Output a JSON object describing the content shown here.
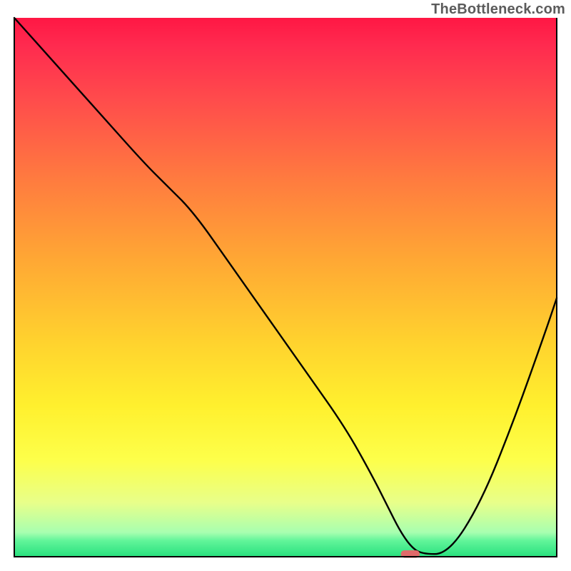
{
  "watermark": "TheBottleneck.com",
  "chart_data": {
    "type": "line",
    "title": "",
    "xlabel": "",
    "ylabel": "",
    "xlim": [
      0,
      100
    ],
    "ylim": [
      0,
      100
    ],
    "axes_visible": false,
    "grid": false,
    "legend": false,
    "background": {
      "type": "vertical-gradient",
      "description": "Vertical color gradient from red at top through orange, yellow, to green at bottom, indicating bottleneck severity by vertical position.",
      "stops": [
        {
          "pos": 0.0,
          "color": "#ff1744"
        },
        {
          "pos": 0.05,
          "color": "#ff2a4f"
        },
        {
          "pos": 0.15,
          "color": "#ff4b4c"
        },
        {
          "pos": 0.3,
          "color": "#ff7b3f"
        },
        {
          "pos": 0.45,
          "color": "#ffa834"
        },
        {
          "pos": 0.6,
          "color": "#ffd22e"
        },
        {
          "pos": 0.72,
          "color": "#fff02e"
        },
        {
          "pos": 0.82,
          "color": "#fdff4a"
        },
        {
          "pos": 0.9,
          "color": "#e8ff8a"
        },
        {
          "pos": 0.955,
          "color": "#a8ffb0"
        },
        {
          "pos": 0.97,
          "color": "#62f59a"
        },
        {
          "pos": 1.0,
          "color": "#28e07e"
        }
      ]
    },
    "series": [
      {
        "name": "bottleneck-curve",
        "color": "#000000",
        "stroke_width": 2.4,
        "x": [
          0,
          8,
          16,
          24,
          28,
          33,
          40,
          47,
          54,
          61,
          66,
          69,
          71,
          73,
          75,
          80,
          86,
          92,
          98,
          100
        ],
        "y": [
          100,
          91,
          82,
          73,
          69,
          64,
          54,
          44,
          34,
          24,
          15,
          9,
          5,
          2,
          0.5,
          0.5,
          10,
          25,
          42,
          48
        ]
      }
    ],
    "marker": {
      "name": "optimal-point",
      "shape": "rounded-rect",
      "color": "#e06a6a",
      "x": 73,
      "y": 0.5,
      "width_frac": 0.035,
      "height_frac": 0.014
    },
    "frame": {
      "color": "#000000",
      "width": 2
    }
  }
}
